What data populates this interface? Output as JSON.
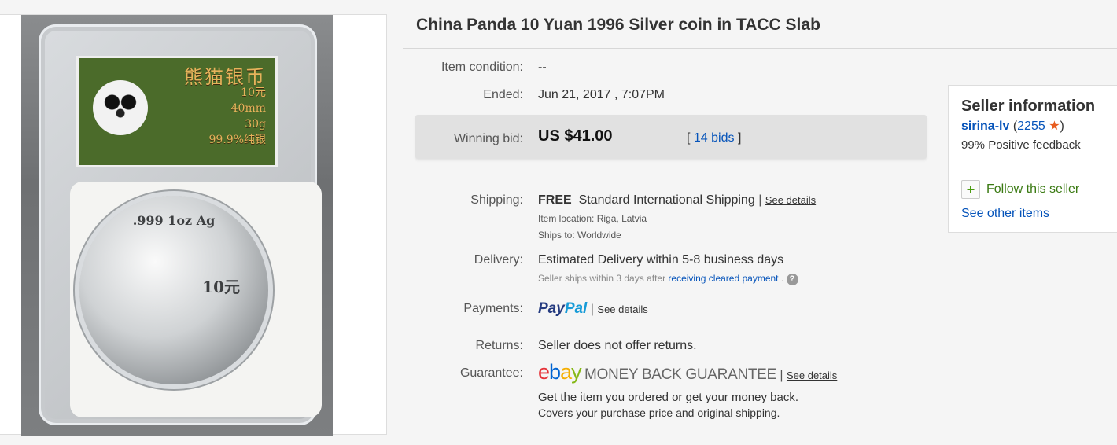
{
  "listing": {
    "title": "China Panda 10 Yuan 1996 Silver coin in TACC Slab"
  },
  "photo": {
    "label_title": "熊猫银币",
    "label_value": "10元",
    "label_size": "40mm",
    "label_weight": "30g",
    "label_purity": "99.9%纯银",
    "coin_inscription": ".999 1oz Ag",
    "coin_value": "10元"
  },
  "details": {
    "condition_label": "Item condition:",
    "condition_value": "--",
    "ended_label": "Ended:",
    "ended_value": "Jun 21, 2017 , 7:07PM",
    "winning_label": "Winning bid:",
    "winning_value": "US $41.00",
    "bids_open": "[",
    "bids_link": "14 bids",
    "bids_close": "]",
    "shipping_label": "Shipping:",
    "shipping_free": "FREE",
    "shipping_method": "Standard International Shipping",
    "shipping_see_details": "See details",
    "item_location_label": "Item location:",
    "item_location_value": "Riga, Latvia",
    "ships_to_label": "Ships to:",
    "ships_to_value": "Worldwide",
    "delivery_label": "Delivery:",
    "delivery_value": "Estimated Delivery within 5-8 business days",
    "delivery_note": "Seller ships within 3 days after",
    "delivery_note_link": "receiving cleared payment",
    "delivery_note_end": ".",
    "payments_label": "Payments:",
    "paypal_part1": "Pay",
    "paypal_part2": "Pal",
    "payments_see_details": "See details",
    "returns_label": "Returns:",
    "returns_value": "Seller does not offer returns.",
    "guarantee_label": "Guarantee:",
    "ebay_e": "e",
    "ebay_b": "b",
    "ebay_a": "a",
    "ebay_y": "y",
    "mbg": "MONEY BACK GUARANTEE",
    "guarantee_see_details": "See details",
    "guarantee_line1": "Get the item you ordered or get your money back.",
    "guarantee_line2": "Covers your purchase price and original shipping."
  },
  "seller": {
    "title": "Seller information",
    "name": "sirina-lv",
    "feedback_count": "2255",
    "positive": "99% Positive feedback",
    "follow": "Follow this seller",
    "other_items": "See other items"
  },
  "colors": {
    "link": "#0654ba",
    "follow": "#3a7a12",
    "star": "#e85c1f"
  },
  "icons": [
    "help-icon",
    "star-icon",
    "plus-icon"
  ]
}
